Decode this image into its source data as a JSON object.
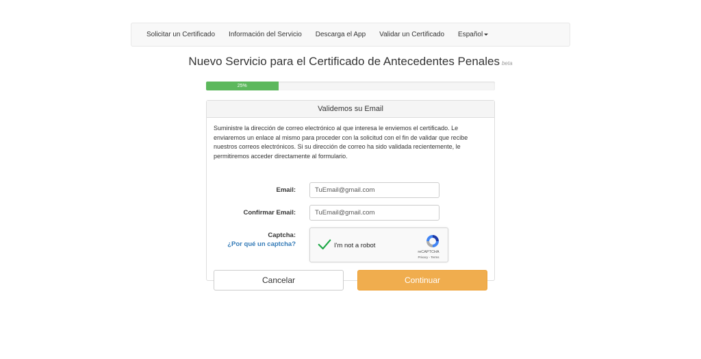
{
  "nav": {
    "items": [
      "Solicitar un Certificado",
      "Información del Servicio",
      "Descarga el App",
      "Validar un Certificado"
    ],
    "language": "Español"
  },
  "header": {
    "title": "Nuevo Servicio para el Certificado de Antecedentes Penales",
    "beta": "beta"
  },
  "progress": {
    "label": "25%",
    "value": 25,
    "color": "#5cb85c"
  },
  "panel": {
    "heading": "Validemos su Email",
    "description": "Suministre la dirección de correo electrónico al que interesa le enviemos el certificado. Le enviaremos un enlace al mismo para proceder con la solicitud con el fin de validar que recibe nuestros correos electrónicos. Si su dirección de correo ha sido validada recientemente, le permitiremos acceder directamente al formulario.",
    "email_label": "Email:",
    "email_placeholder": "TuEmail@gmail.com",
    "confirm_label": "Confirmar Email:",
    "confirm_placeholder": "TuEmail@gmail.com",
    "captcha_label": "Captcha:",
    "captcha_why": "¿Por qué un captcha?",
    "recaptcha": {
      "text": "I'm not a robot",
      "brand": "reCAPTCHA",
      "terms": "Privacy - Terms"
    },
    "cancel_label": "Cancelar",
    "continue_label": "Continuar"
  },
  "colors": {
    "accent": "#f0ad4e",
    "link": "#337ab7",
    "success": "#5cb85c"
  }
}
